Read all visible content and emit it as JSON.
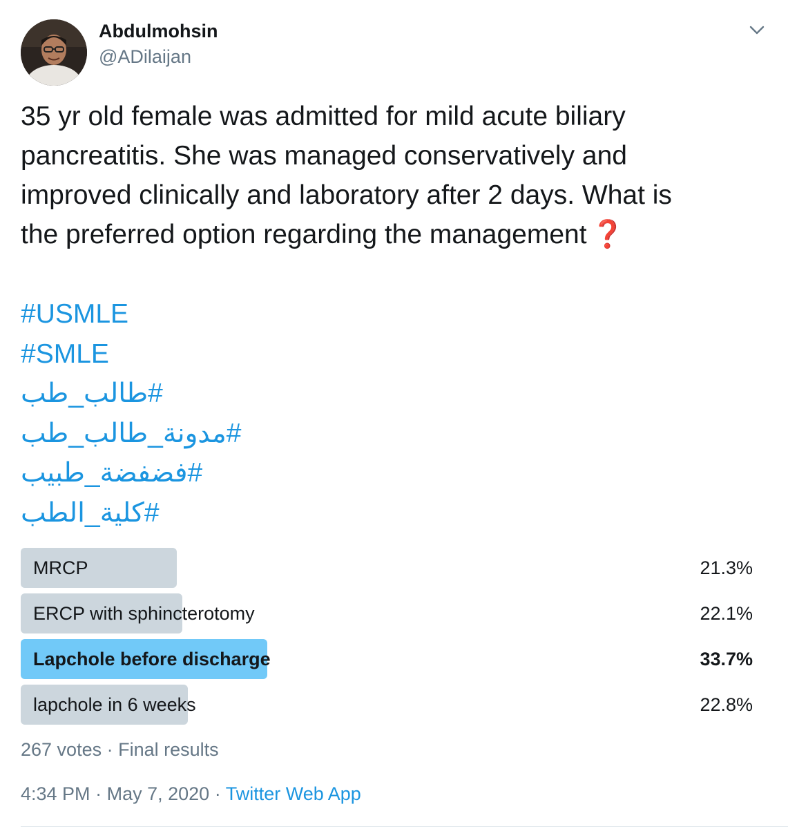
{
  "author": {
    "display_name": "Abdulmohsin",
    "handle": "@ADilaijan"
  },
  "tweet": {
    "lines": [
      "35 yr old female was admitted for mild acute biliary",
      "pancreatitis. She was managed conservatively and",
      "improved clinically and laboratory after 2 days. What is",
      "the preferred option regarding the management"
    ],
    "emoji": "❓",
    "hashtags": [
      "#USMLE",
      "#SMLE",
      "#طالب_طب",
      "#مدونة_طالب_طب",
      "#فضفضة_طبيب",
      "#كلية_الطب"
    ]
  },
  "poll": {
    "options": [
      {
        "label": "MRCP",
        "percent_text": "21.3%",
        "percent": 21.3,
        "winner": false
      },
      {
        "label": "ERCP with sphincterotomy",
        "percent_text": "22.1%",
        "percent": 22.1,
        "winner": false
      },
      {
        "label": "Lapchole before discharge",
        "percent_text": "33.7%",
        "percent": 33.7,
        "winner": true
      },
      {
        "label": "lapchole in 6 weeks",
        "percent_text": "22.8%",
        "percent": 22.8,
        "winner": false
      }
    ],
    "votes": "267 votes",
    "separator": "·",
    "status": "Final results"
  },
  "meta": {
    "time": "4:34 PM",
    "date": "May 7, 2020",
    "separator": "·",
    "source": "Twitter Web App"
  },
  "icons": {
    "caret": "chevron-down-icon",
    "profile": "avatar"
  },
  "colors": {
    "link": "#1b95e0",
    "winner_bar": "#71c9f8",
    "bar": "#ccd6dd",
    "muted": "#657786"
  }
}
